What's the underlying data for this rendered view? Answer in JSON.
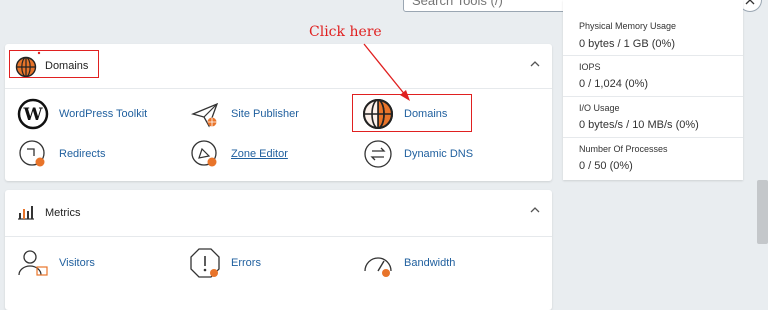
{
  "search": {
    "placeholder": "Search Tools (/)"
  },
  "annotation": {
    "text": "Click here",
    "color": "#e02020"
  },
  "domains_section": {
    "title": "Domains",
    "tools": [
      {
        "label": "WordPress Toolkit",
        "icon": "wordpress-icon"
      },
      {
        "label": "Site Publisher",
        "icon": "site-publisher-icon"
      },
      {
        "label": "Domains",
        "icon": "globe-icon"
      },
      {
        "label": "Redirects",
        "icon": "redirects-icon"
      },
      {
        "label": "Zone Editor",
        "icon": "zone-editor-icon"
      },
      {
        "label": "Dynamic DNS",
        "icon": "dynamic-dns-icon"
      }
    ]
  },
  "metrics_section": {
    "title": "Metrics",
    "tools": [
      {
        "label": "Visitors",
        "icon": "visitors-icon"
      },
      {
        "label": "Errors",
        "icon": "errors-icon"
      },
      {
        "label": "Bandwidth",
        "icon": "bandwidth-icon"
      }
    ]
  },
  "stats": [
    {
      "label": "Physical Memory Usage",
      "value": "0 bytes / 1 GB   (0%)"
    },
    {
      "label": "IOPS",
      "value": "0 / 1,024   (0%)"
    },
    {
      "label": "I/O Usage",
      "value": "0 bytes/s / 10 MB/s   (0%)"
    },
    {
      "label": "Number Of Processes",
      "value": "0 / 50   (0%)"
    }
  ],
  "colors": {
    "accent": "#e8742a",
    "link": "#1f5f9e",
    "highlight": "#e02020"
  }
}
